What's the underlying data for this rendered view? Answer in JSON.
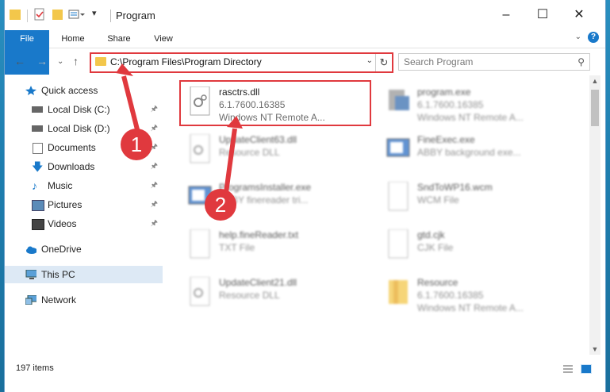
{
  "window": {
    "title": "Program"
  },
  "ribbon": {
    "tabs": [
      "File",
      "Home",
      "Share",
      "View"
    ],
    "help": "?"
  },
  "address": {
    "path": "C:\\Program Files\\Program Directory"
  },
  "search": {
    "placeholder": "Search Program"
  },
  "sidebar": {
    "items": [
      {
        "label": "Quick access"
      },
      {
        "label": "Local Disk (C:)"
      },
      {
        "label": "Local Disk (D:)"
      },
      {
        "label": "Documents"
      },
      {
        "label": "Downloads"
      },
      {
        "label": "Music"
      },
      {
        "label": "Pictures"
      },
      {
        "label": "Videos"
      },
      {
        "label": "OneDrive"
      },
      {
        "label": "This PC"
      },
      {
        "label": "Network"
      }
    ]
  },
  "files": [
    {
      "name": "rasctrs.dll",
      "line1": "6.1.7600.16385",
      "line2": "Windows NT Remote A..."
    },
    {
      "name": "program.exe",
      "line1": "6.1.7600.16385",
      "line2": "Windows NT Remote A..."
    },
    {
      "name": "UpdateClient63.dll",
      "line1": "Resource DLL",
      "line2": ""
    },
    {
      "name": "FineExec.exe",
      "line1": "ABBY background exe...",
      "line2": ""
    },
    {
      "name": "ProgramsInstaller.exe",
      "line1": "ABBY finereader tri...",
      "line2": ""
    },
    {
      "name": "SndToWP16.wcm",
      "line1": "WCM File",
      "line2": ""
    },
    {
      "name": "help.fineReader.txt",
      "line1": "TXT File",
      "line2": ""
    },
    {
      "name": "gtd.cjk",
      "line1": "CJK File",
      "line2": ""
    },
    {
      "name": "UpdateClient21.dll",
      "line1": "Resource DLL",
      "line2": ""
    },
    {
      "name": "Resource",
      "line1": "6.1.7600.16385",
      "line2": "Windows NT Remote A..."
    }
  ],
  "status": {
    "items": "197 items"
  },
  "annotations": {
    "step1": "1",
    "step2": "2"
  },
  "colors": {
    "accent": "#1979ca",
    "highlight": "#e0393e",
    "folder": "#f3c74b",
    "selected": "#dde9f5"
  }
}
